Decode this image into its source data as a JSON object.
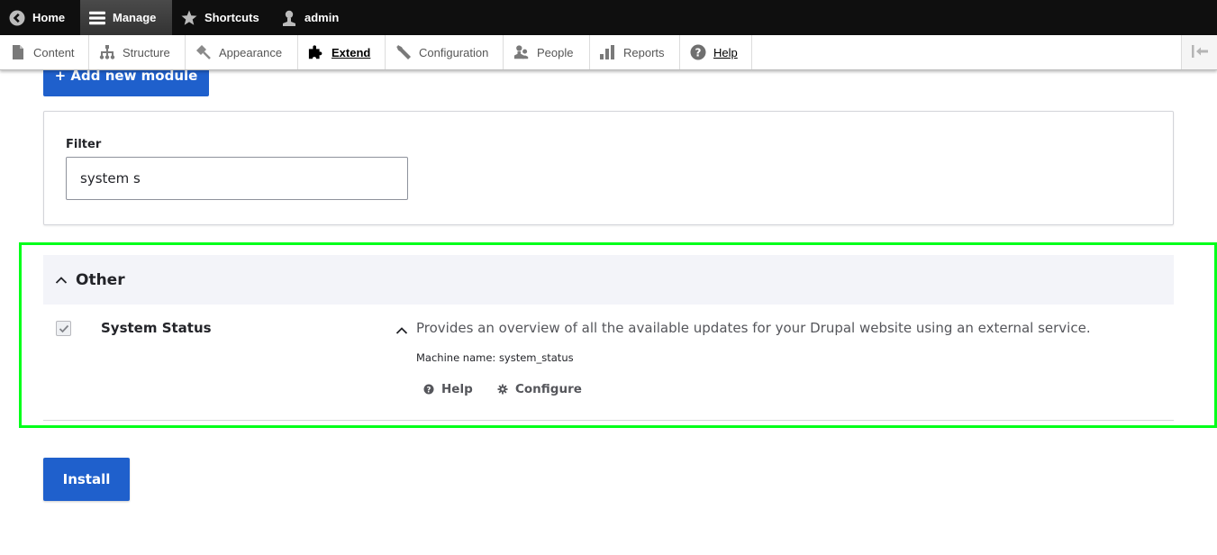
{
  "toolbar": {
    "items": [
      {
        "label": "Home",
        "icon": "chevron-left-circle-icon"
      },
      {
        "label": "Manage",
        "icon": "hamburger-menu-icon",
        "active": true
      },
      {
        "label": "Shortcuts",
        "icon": "star-icon"
      },
      {
        "label": "admin",
        "icon": "user-icon"
      }
    ]
  },
  "tray": {
    "items": [
      {
        "label": "Content",
        "icon": "document-icon"
      },
      {
        "label": "Structure",
        "icon": "sitemap-icon"
      },
      {
        "label": "Appearance",
        "icon": "paint-roller-icon"
      },
      {
        "label": "Extend",
        "icon": "puzzle-piece-icon",
        "active": true
      },
      {
        "label": "Configuration",
        "icon": "wrench-icon"
      },
      {
        "label": "People",
        "icon": "people-icon"
      },
      {
        "label": "Reports",
        "icon": "bar-chart-icon"
      },
      {
        "label": "Help",
        "icon": "question-circle-icon"
      }
    ],
    "toggle_icon": "collapse-orientation-icon"
  },
  "main": {
    "add_module_label": "+ Add new module",
    "filter": {
      "label": "Filter",
      "value": "system s"
    },
    "group": {
      "title": "Other",
      "expanded": true,
      "modules": [
        {
          "name": "System Status",
          "checked": true,
          "disabled": true,
          "description": "Provides an overview of all the available updates for your Drupal website using an external service.",
          "machine_name": "Machine name: system_status",
          "links": [
            {
              "label": "Help",
              "icon": "question-circle-icon"
            },
            {
              "label": "Configure",
              "icon": "gear-icon"
            }
          ]
        }
      ]
    },
    "install_label": "Install"
  },
  "colors": {
    "primary": "#1f60cc",
    "toolbar_bg": "#0f0f0f",
    "highlight": "#00ff1a",
    "group_header_bg": "#f3f4f9"
  }
}
